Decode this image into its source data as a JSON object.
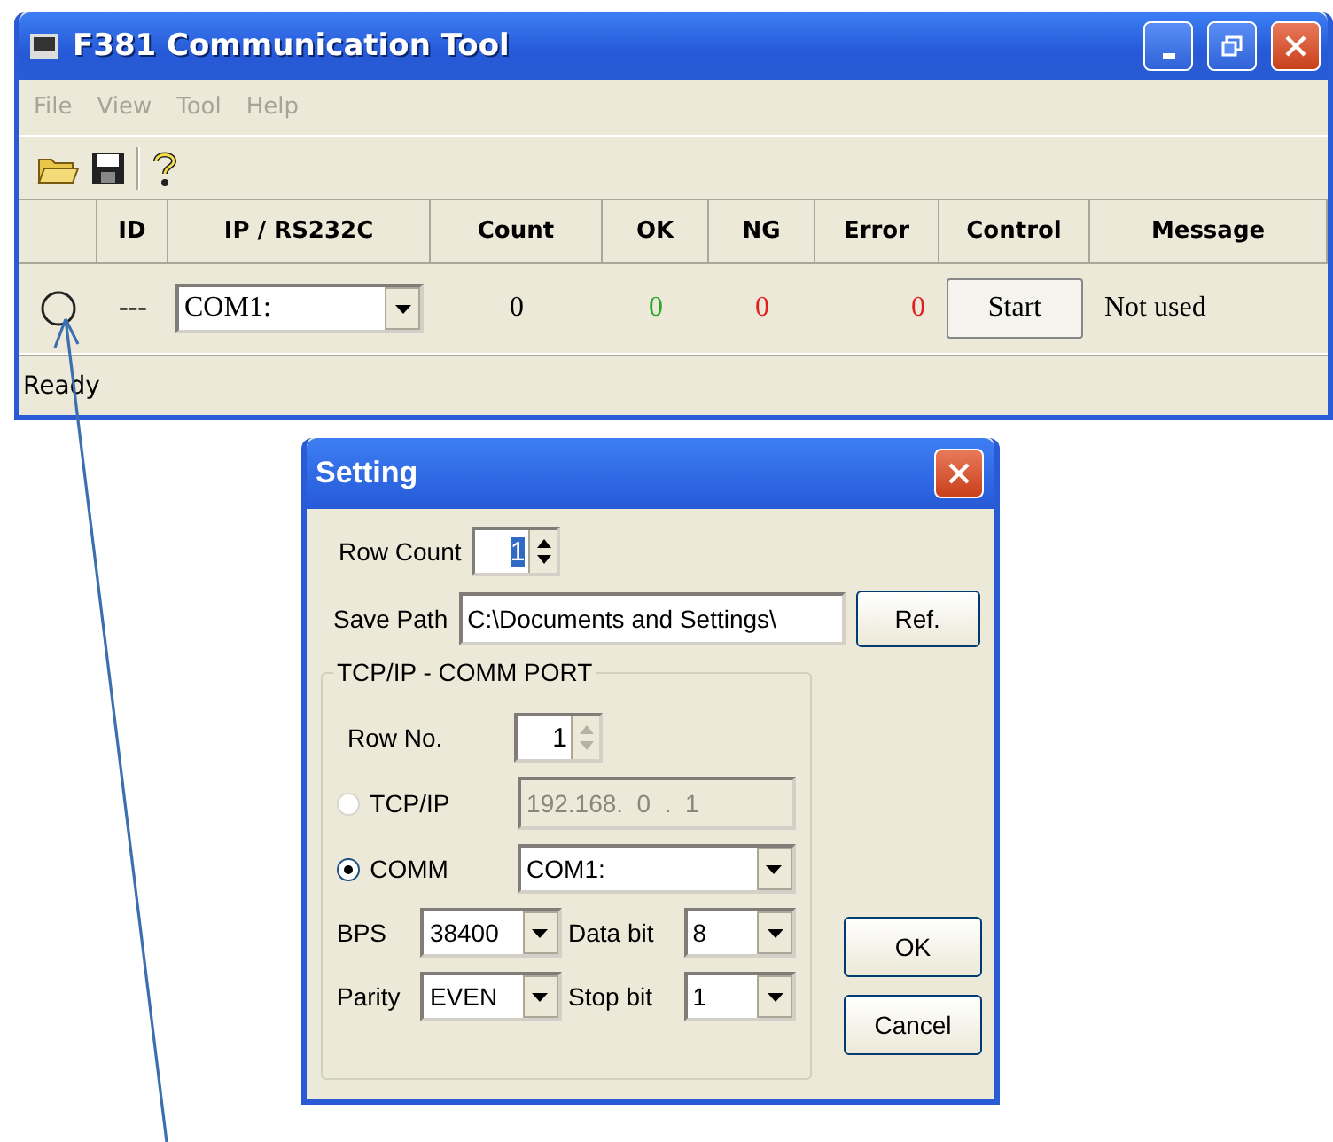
{
  "window": {
    "title": "F381 Communication Tool"
  },
  "menu": [
    {
      "label": "File",
      "disabled": true
    },
    {
      "label": "View",
      "disabled": true
    },
    {
      "label": "Tool",
      "disabled": true
    },
    {
      "label": "Help",
      "disabled": true
    }
  ],
  "table": {
    "columns": [
      "ID",
      "IP / RS232C",
      "Count",
      "OK",
      "NG",
      "Error",
      "Control",
      "Message"
    ],
    "rows": [
      {
        "id": "---",
        "port": "COM1:",
        "count": "0",
        "ok": "0",
        "ng": "0",
        "error": "0",
        "control": "Start",
        "message": "Not used"
      }
    ]
  },
  "status_bar": "Ready",
  "dialog": {
    "title": "Setting",
    "row_count": {
      "label": "Row Count",
      "value": "1"
    },
    "save_path": {
      "label": "Save Path",
      "value": "C:\\Documents and Settings\\",
      "button": "Ref."
    },
    "group": {
      "title": "TCP/IP - COMM PORT",
      "row_no": {
        "label": "Row No.",
        "value": "1"
      },
      "connections": [
        {
          "label": "TCP/IP",
          "selected": false,
          "value": "192.168.  0  .  1"
        },
        {
          "label": "COMM",
          "selected": true,
          "value": "COM1:"
        }
      ],
      "settings": [
        {
          "label": "BPS",
          "value": "38400",
          "label2": "Data bit",
          "value2": "8"
        },
        {
          "label": "Parity",
          "value": "EVEN",
          "label2": "Stop bit",
          "value2": "1"
        }
      ]
    },
    "buttons": [
      "OK",
      "Cancel"
    ]
  }
}
